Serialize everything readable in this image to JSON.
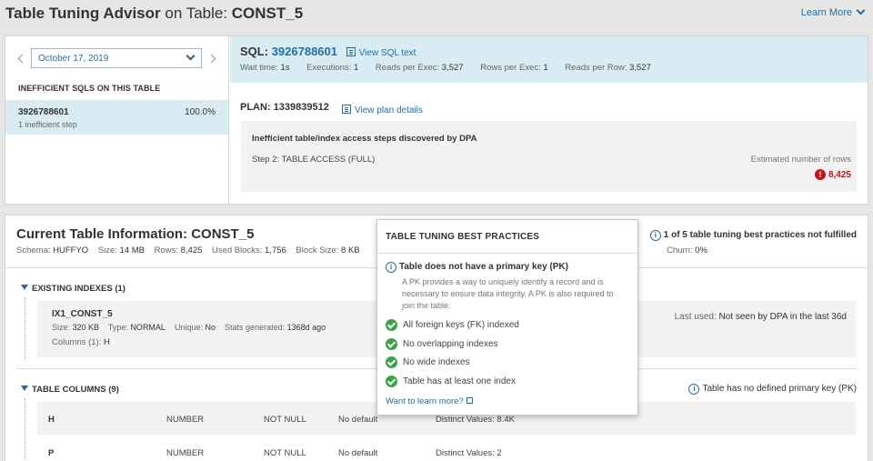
{
  "header": {
    "title_prefix": "Table Tuning Advisor",
    "title_mid": " on Table: ",
    "table_name": "CONST_5",
    "learn_more": "Learn More"
  },
  "sidebar": {
    "date": "October 17, 2019",
    "section_title": "INEFFICIENT SQLS ON THIS TABLE",
    "items": [
      {
        "sql_id": "3926788601",
        "percent": "100.0%",
        "sub": "1 inefficient step"
      }
    ]
  },
  "sql": {
    "label": "SQL:",
    "id": "3926788601",
    "view_link": "View SQL text",
    "stats": [
      {
        "label": "Wait time:",
        "value": "1s"
      },
      {
        "label": "Executions:",
        "value": "1"
      },
      {
        "label": "Reads per Exec:",
        "value": "3,527"
      },
      {
        "label": "Rows per Exec:",
        "value": "1"
      },
      {
        "label": "Reads per Row:",
        "value": "3,527"
      }
    ]
  },
  "plan": {
    "label": "PLAN: 1339839512",
    "view_link": "View plan details",
    "box_title": "Inefficient table/index access steps discovered by DPA",
    "step": "Step 2: TABLE ACCESS  (FULL)",
    "est_label": "Estimated number of rows",
    "est_value": "8,425"
  },
  "current": {
    "title": "Current Table Information: CONST_5",
    "stats": [
      {
        "label": "Schema:",
        "value": "HUFFYO"
      },
      {
        "label": "Size:",
        "value": "14 MB"
      },
      {
        "label": "Rows:",
        "value": "8,425"
      },
      {
        "label": "Used Blocks:",
        "value": "1,756"
      },
      {
        "label": "Block Size:",
        "value": "8 KB"
      }
    ],
    "churn_label": "Churn:",
    "churn_value": "0%",
    "warning": "1 of 5 table tuning best practices not fulfilled"
  },
  "indexes": {
    "section": "EXISTING INDEXES (1)",
    "name": "IX1_CONST_5",
    "meta": [
      {
        "label": "Size:",
        "value": "320 KB"
      },
      {
        "label": "Type:",
        "value": "NORMAL"
      },
      {
        "label": "Unique:",
        "value": "No"
      },
      {
        "label": "Stats generated:",
        "value": "1368d ago"
      }
    ],
    "columns_label": "Columns (1):",
    "columns_value": "H",
    "last_used_label": "Last used:",
    "last_used_value": "Not seen by DPA in the last 36d"
  },
  "columns": {
    "section": "TABLE COLUMNS (9)",
    "no_pk": "Table has no defined primary key (PK)",
    "rows": [
      {
        "name": "H",
        "type": "NUMBER",
        "null": "NOT NULL",
        "default": "No default",
        "distinct": "Distinct Values: 8.4K"
      },
      {
        "name": "P",
        "type": "NUMBER",
        "null": "NOT NULL",
        "default": "No default",
        "distinct": "Distinct Values: 2"
      }
    ]
  },
  "popup": {
    "title": "TABLE TUNING BEST PRACTICES",
    "failed_title": "Table does not have a primary key (PK)",
    "failed_desc": "A PK provides a way to uniquely identify a record and is necessary to ensure data integrity. A PK is also required to join the table.",
    "passed": [
      "All foreign keys (FK) indexed",
      "No overlapping indexes",
      "No wide indexes",
      "Table has at least one index"
    ],
    "learn_link": "Want to learn more?"
  },
  "colors": {
    "link": "#1f6fa8",
    "highlight": "#d9ecf4",
    "error": "#c0171f",
    "ok": "#3aa34a"
  }
}
